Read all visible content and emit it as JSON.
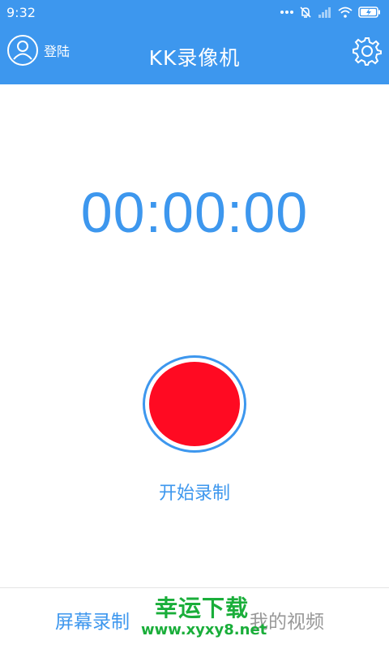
{
  "status_bar": {
    "time": "9:32",
    "icons": [
      "more-dots-icon",
      "alarm-off-icon",
      "signal-icon",
      "wifi-icon",
      "battery-charging-icon"
    ]
  },
  "header": {
    "login_label": "登陆",
    "title": "KK录像机",
    "icons": [
      "user-avatar-icon",
      "gear-icon"
    ]
  },
  "main": {
    "timer": "00:00:00",
    "record_label": "开始录制"
  },
  "bottom_nav": {
    "tabs": [
      {
        "label": "屏幕录制",
        "active": true
      },
      {
        "label": "我的视频",
        "active": false
      }
    ]
  },
  "watermark": {
    "line1": "幸运下载",
    "line2": "www.xyxy8.net"
  },
  "colors": {
    "primary": "#3d97ee",
    "record": "#ff0a22",
    "inactive_tab": "#999999",
    "watermark": "#1aae3a"
  }
}
